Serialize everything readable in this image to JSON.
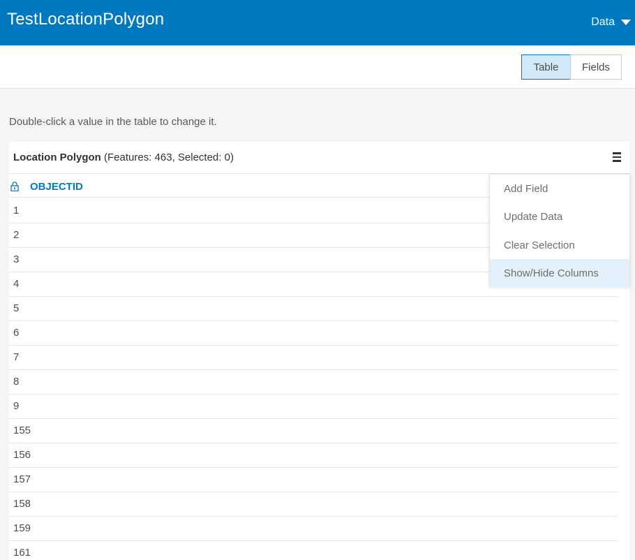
{
  "header": {
    "title": "TestLocationPolygon",
    "data_menu_label": "Data"
  },
  "toolbar": {
    "table_label": "Table",
    "fields_label": "Fields",
    "active_view": "Table"
  },
  "instruction": "Double-click a value in the table to change it.",
  "panel": {
    "layer_name": "Location Polygon",
    "counts": "(Features: 463, Selected: 0)"
  },
  "table": {
    "columns": [
      "OBJECTID"
    ],
    "rows": [
      "1",
      "2",
      "3",
      "4",
      "5",
      "6",
      "7",
      "8",
      "9",
      "155",
      "156",
      "157",
      "158",
      "159",
      "161"
    ]
  },
  "menu": {
    "items": [
      "Add Field",
      "Update Data",
      "Clear Selection",
      "Show/Hide Columns"
    ],
    "hovered": "Show/Hide Columns"
  },
  "colors": {
    "brand": "#0079c1",
    "active_segment": "#d2e9f9",
    "menu_hover": "#e2f1fb"
  }
}
